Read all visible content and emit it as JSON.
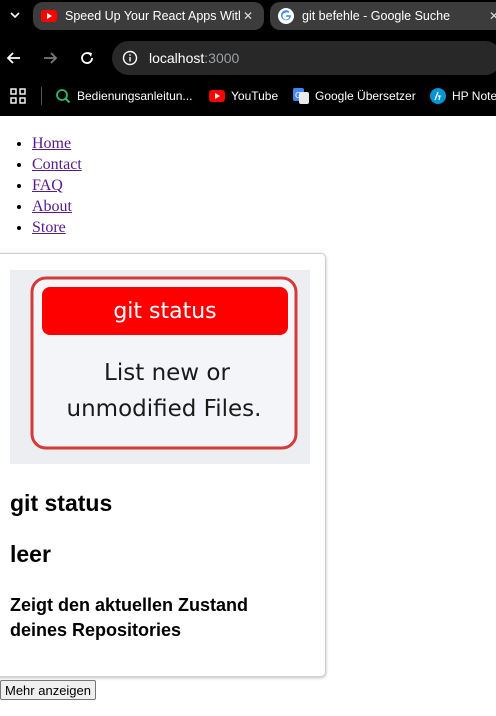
{
  "browser": {
    "tabs": [
      {
        "title": "Speed Up Your React Apps With",
        "favicon": "youtube-icon",
        "active": false
      },
      {
        "title": "git befehle - Google Suche",
        "favicon": "google-icon",
        "active": true
      }
    ],
    "url": {
      "host": "localhost",
      "port": ":3000"
    },
    "bookmarks": [
      {
        "label": "Bedienungsanleitun...",
        "icon": "manual-icon"
      },
      {
        "label": "YouTube",
        "icon": "youtube-icon"
      },
      {
        "label": "Google Übersetzer",
        "icon": "translate-icon"
      },
      {
        "label": "HP Note",
        "icon": "hp-icon"
      }
    ]
  },
  "nav": {
    "items": [
      {
        "label": "Home"
      },
      {
        "label": "Contact"
      },
      {
        "label": "FAQ"
      },
      {
        "label": "About"
      },
      {
        "label": "Store"
      }
    ]
  },
  "card": {
    "image": {
      "banner_text": "git status",
      "body_line1": "List new or",
      "body_line2": "unmodified Files."
    },
    "title": "git status",
    "subtitle": "leer",
    "description": "Zeigt den aktuellen Zustand deines Repositories"
  },
  "actions": {
    "more_label": "Mehr anzeigen"
  },
  "colors": {
    "banner_red": "#ff0000",
    "border_red": "#d43a3a",
    "link_visited": "#551a8b"
  }
}
